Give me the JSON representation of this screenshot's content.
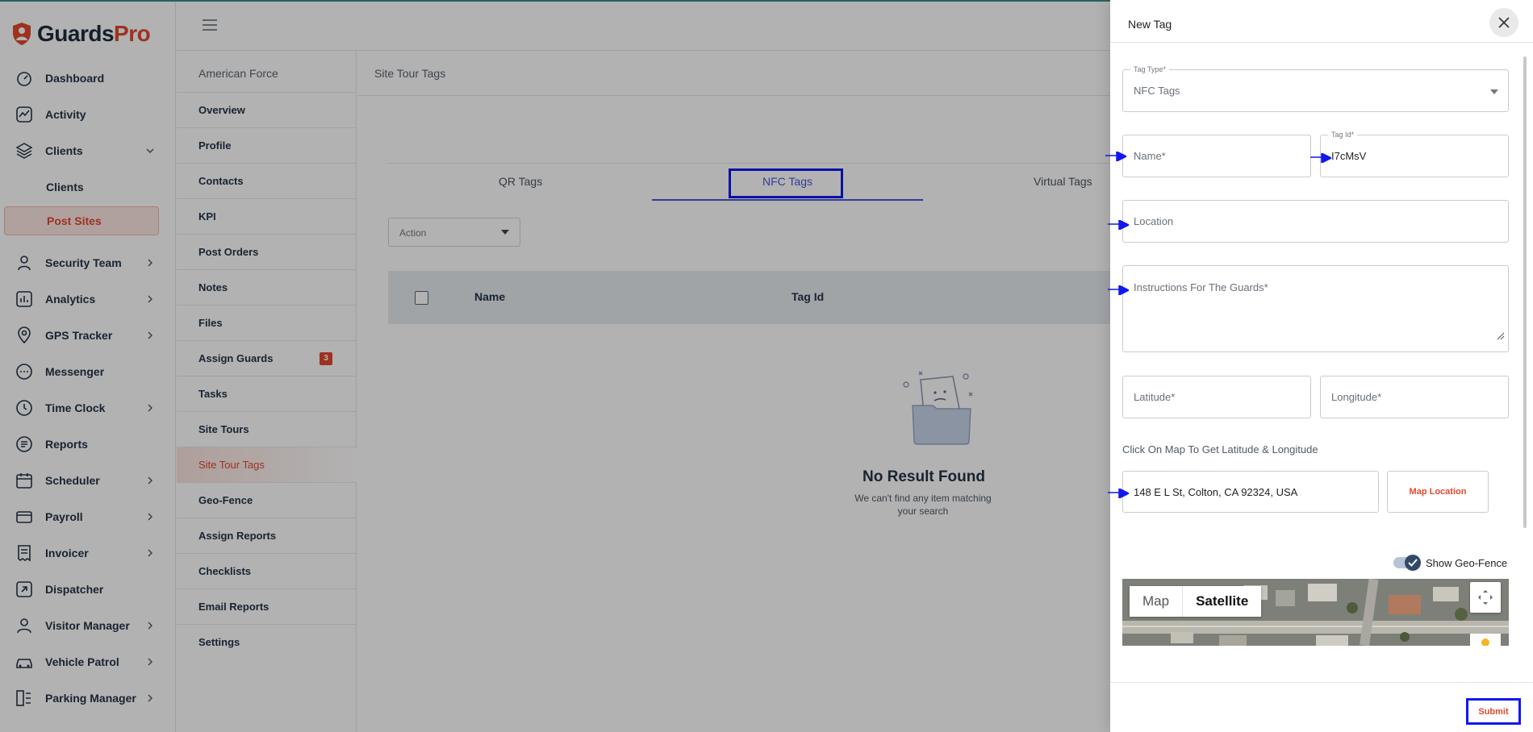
{
  "brand": {
    "guards": "Guards",
    "pro": "Pro"
  },
  "sidebar": {
    "items": [
      {
        "label": "Dashboard",
        "icon": "dashboard-icon"
      },
      {
        "label": "Activity",
        "icon": "activity-icon"
      },
      {
        "label": "Clients",
        "icon": "clients-icon",
        "expanded": true
      },
      {
        "label": "Clients",
        "sub": true
      },
      {
        "label": "Post Sites",
        "sub": true,
        "active": true
      },
      {
        "label": "Security Team",
        "icon": "security-team-icon"
      },
      {
        "label": "Analytics",
        "icon": "analytics-icon"
      },
      {
        "label": "GPS Tracker",
        "icon": "gps-icon"
      },
      {
        "label": "Messenger",
        "icon": "messenger-icon"
      },
      {
        "label": "Time Clock",
        "icon": "clock-icon"
      },
      {
        "label": "Reports",
        "icon": "reports-icon"
      },
      {
        "label": "Scheduler",
        "icon": "calendar-icon"
      },
      {
        "label": "Payroll",
        "icon": "payroll-icon"
      },
      {
        "label": "Invoicer",
        "icon": "invoice-icon"
      },
      {
        "label": "Dispatcher",
        "icon": "dispatch-icon"
      },
      {
        "label": "Visitor Manager",
        "icon": "visitor-icon"
      },
      {
        "label": "Vehicle Patrol",
        "icon": "car-icon"
      },
      {
        "label": "Parking Manager",
        "icon": "parking-icon"
      }
    ]
  },
  "site": {
    "name": "American Force",
    "items": [
      {
        "label": "Overview"
      },
      {
        "label": "Profile"
      },
      {
        "label": "Contacts"
      },
      {
        "label": "KPI"
      },
      {
        "label": "Post Orders"
      },
      {
        "label": "Notes"
      },
      {
        "label": "Files"
      },
      {
        "label": "Assign Guards",
        "badge": "3"
      },
      {
        "label": "Tasks"
      },
      {
        "label": "Site Tours"
      },
      {
        "label": "Site Tour Tags",
        "active": true
      },
      {
        "label": "Geo-Fence"
      },
      {
        "label": "Assign Reports"
      },
      {
        "label": "Checklists"
      },
      {
        "label": "Email Reports"
      },
      {
        "label": "Settings"
      }
    ]
  },
  "main": {
    "title": "Site Tour Tags",
    "tabs": [
      "QR Tags",
      "NFC Tags",
      "Virtual Tags"
    ],
    "active_tab": "NFC Tags",
    "action_label": "Action",
    "columns": [
      "Name",
      "Tag Id"
    ],
    "empty": {
      "title": "No Result Found",
      "subtitle": "We can't find any item matching your search"
    }
  },
  "drawer": {
    "title": "New Tag",
    "tag_type": {
      "label": "Tag Type*",
      "value": "NFC Tags"
    },
    "name": {
      "placeholder": "Name*"
    },
    "tag_id": {
      "label": "Tag Id*",
      "value": "I7cMsV"
    },
    "location": {
      "placeholder": "Location"
    },
    "instructions": {
      "placeholder": "Instructions For The Guards*"
    },
    "latitude": {
      "placeholder": "Latitude*"
    },
    "longitude": {
      "placeholder": "Longitude*"
    },
    "hint": "Click On Map To Get Latitude & Longitude",
    "address": "148 E L St, Colton, CA 92324, USA",
    "map_location": "Map Location",
    "show_geofence": "Show Geo-Fence",
    "map_tabs": [
      "Map",
      "Satellite"
    ],
    "submit": "Submit"
  },
  "colors": {
    "accent": "#e2472e",
    "highlight": "#1118ee",
    "tab_underline": "#4b55d8"
  }
}
